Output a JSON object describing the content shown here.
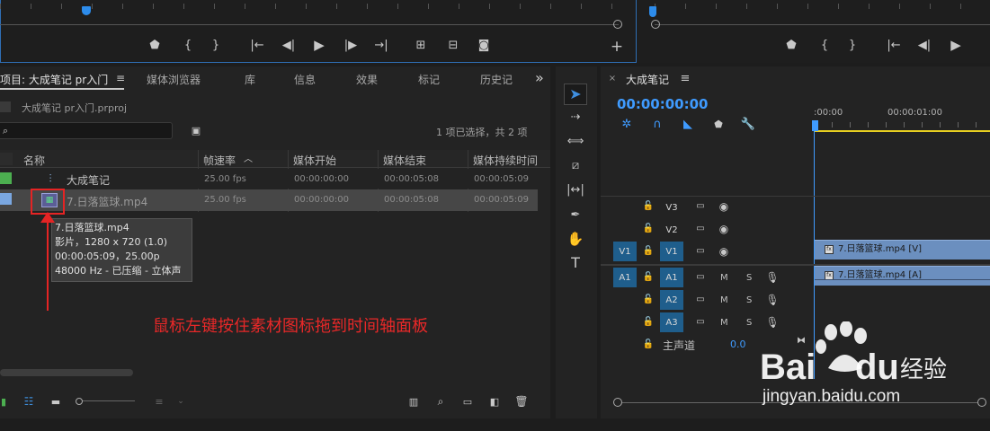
{
  "source_monitor": {
    "controls": [
      "marker",
      "in-point",
      "out-point",
      "go-to-in",
      "step-back",
      "play",
      "step-forward",
      "go-to-out",
      "insert",
      "overwrite",
      "export-frame",
      "add"
    ]
  },
  "program_monitor": {
    "controls": [
      "marker",
      "in-point",
      "out-point",
      "go-to-in",
      "step-back",
      "play"
    ]
  },
  "project_panel": {
    "tab_title": "项目: 大成笔记 pr入门",
    "tabs": [
      "媒体浏览器",
      "库",
      "信息",
      "效果",
      "标记",
      "历史记"
    ],
    "overflow_glyph": "»",
    "project_file": "大成笔记 pr入门.prproj",
    "selection_status": "1 项已选择，共 2 项",
    "columns": [
      "名称",
      "帧速率",
      "媒体开始",
      "媒体结束",
      "媒体持续时间"
    ],
    "rows": [
      {
        "name": "大成笔记",
        "fps": "25.00 fps",
        "start": "00:00:00:00",
        "end": "00:00:05:08",
        "duration": "00:00:05:09",
        "label_color": "#4caf50"
      },
      {
        "name": "7.日落篮球.mp4",
        "fps": "25.00 fps",
        "start": "00:00:00:00",
        "end": "00:00:05:08",
        "duration": "00:00:05:09",
        "label_color": "#7aa7e0"
      }
    ],
    "tooltip": {
      "line1": "7.日落篮球.mp4",
      "line2": "影片，1280 x 720 (1.0)",
      "line3": "00:00:05:09，25.00p",
      "line4": "48000 Hz - 已压缩 - 立体声"
    },
    "annotation": "鼠标左键按住素材图标拖到时间轴面板"
  },
  "timeline": {
    "tab_title": "大成笔记",
    "timecode": "00:00:00:00",
    "ruler": [
      ":00:00",
      "00:00:01:00"
    ],
    "video_tracks": [
      {
        "label": "V3"
      },
      {
        "label": "V2"
      },
      {
        "label": "V1",
        "source": "V1"
      }
    ],
    "audio_tracks": [
      {
        "label": "A1",
        "source": "A1",
        "m": "M",
        "s": "S"
      },
      {
        "label": "A2",
        "m": "M",
        "s": "S"
      },
      {
        "label": "A3",
        "m": "M",
        "s": "S"
      }
    ],
    "master": {
      "label": "主声道",
      "value": "0.0"
    },
    "clips": {
      "video": "7.日落篮球.mp4 [V]",
      "audio": "7.日落篮球.mp4 [A]"
    }
  },
  "watermark": {
    "text": "jingyan.baidu.com"
  }
}
